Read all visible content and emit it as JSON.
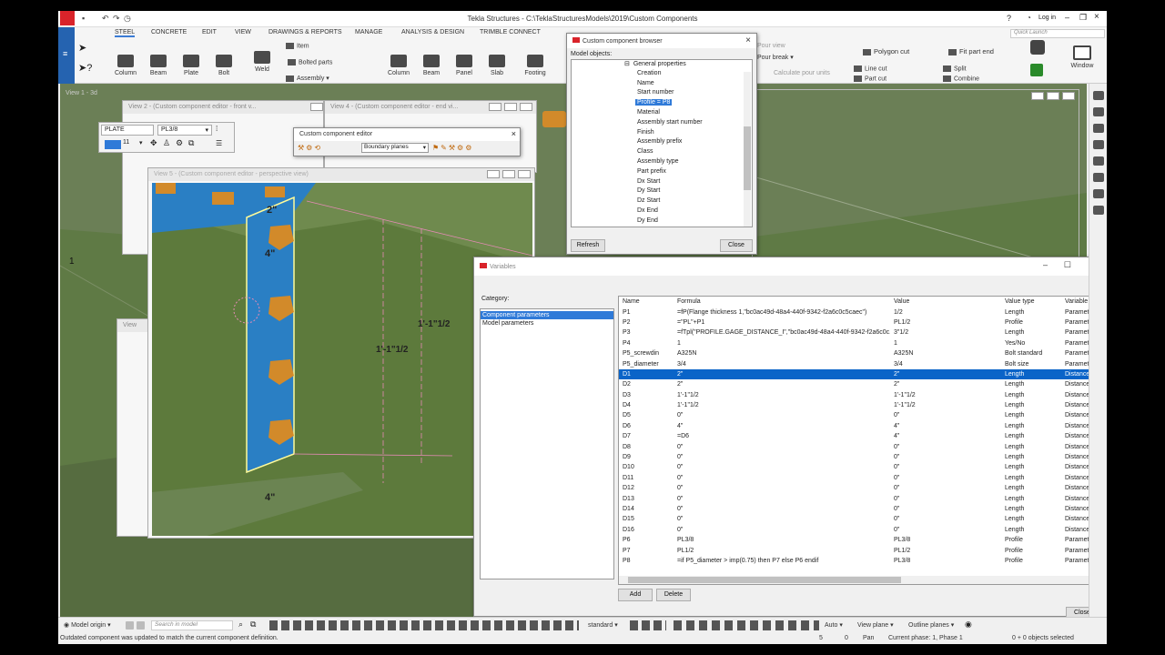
{
  "app": {
    "title": "Tekla Structures - C:\\TeklaStructuresModels\\2019\\Custom Components",
    "login": "Log in",
    "quick_launch": "Quick Launch"
  },
  "menu_tabs": [
    "STEEL",
    "CONCRETE",
    "EDIT",
    "VIEW",
    "DRAWINGS & REPORTS",
    "MANAGE",
    "ANALYSIS & DESIGN",
    "TRIMBLE CONNECT"
  ],
  "ribbon": {
    "steel": [
      {
        "label": "Column",
        "icon": "column-icon"
      },
      {
        "label": "Beam",
        "icon": "beam-icon"
      },
      {
        "label": "Plate",
        "icon": "plate-icon"
      },
      {
        "label": "Bolt",
        "icon": "bolt-icon"
      },
      {
        "label": "Weld",
        "icon": "weld-icon"
      }
    ],
    "steel_small": [
      "Item",
      "Bolted parts",
      "Assembly"
    ],
    "concrete": [
      {
        "label": "Column",
        "icon": "column-icon"
      },
      {
        "label": "Beam",
        "icon": "beam-icon"
      },
      {
        "label": "Panel",
        "icon": "panel-icon"
      },
      {
        "label": "Slab",
        "icon": "slab-icon"
      },
      {
        "label": "Footing",
        "icon": "footing-icon"
      }
    ],
    "pour": [
      "Pour view",
      "Pour break",
      "Calculate pour units"
    ],
    "edit_small": [
      "Polygon cut",
      "Line cut",
      "Part cut",
      "Fit part end",
      "Split",
      "Combine"
    ],
    "window_label": "Window"
  },
  "views": {
    "v1": "View 1 - 3d",
    "v2": "View 2 - (Custom component editor - front v...",
    "v4": "View 4 - (Custom component editor - end vi...",
    "v5": "View 5 - (Custom component editor - perspective view)",
    "vleft": "View"
  },
  "plate_toolbar": {
    "type": "PLATE",
    "profile": "PL3/8",
    "number": "11"
  },
  "cce": {
    "title": "Custom component editor",
    "dropdown": "Boundary planes"
  },
  "browser": {
    "title": "Custom component browser",
    "label": "Model objects:",
    "root": "General properties",
    "items": [
      "Creation",
      "Name",
      "Start number",
      "Profile = P8",
      "Material",
      "Assembly start number",
      "Finish",
      "Assembly prefix",
      "Class",
      "Assembly type",
      "Part prefix",
      "Dx Start",
      "Dy Start",
      "Dz Start",
      "Dx End",
      "Dy End"
    ],
    "selected_index": 3,
    "refresh": "Refresh",
    "close": "Close"
  },
  "variables": {
    "title": "Variables",
    "category_label": "Category:",
    "categories": [
      "Component parameters",
      "Model parameters"
    ],
    "columns": [
      "Name",
      "Formula",
      "Value",
      "Value type",
      "Variable typ"
    ],
    "rows": [
      [
        "P1",
        "=fP(Flange thickness 1,\"bc0ac49d-48a4-440f-9342-f2a6c0c5caec\")",
        "1/2",
        "Length",
        "Parameter"
      ],
      [
        "P2",
        "=\"PL\"+P1",
        "PL1/2",
        "Profile",
        "Parameter"
      ],
      [
        "P3",
        "=fTpl(\"PROFILE.GAGE_DISTANCE_I\",\"bc0ac49d-48a4-440f-9342-f2a6c0c...",
        "3\"1/2",
        "Length",
        "Parameter"
      ],
      [
        "P4",
        "1",
        "1",
        "Yes/No",
        "Parameter"
      ],
      [
        "P5_screwdin",
        "A325N",
        "A325N",
        "Bolt standard",
        "Parameter"
      ],
      [
        "P5_diameter",
        "3/4",
        "3/4",
        "Bolt size",
        "Parameter"
      ],
      [
        "D1",
        "2\"",
        "2\"",
        "Length",
        "Distance"
      ],
      [
        "D2",
        "2\"",
        "2\"",
        "Length",
        "Distance"
      ],
      [
        "D3",
        "1'-1\"1/2",
        "1'-1\"1/2",
        "Length",
        "Distance"
      ],
      [
        "D4",
        "1'-1\"1/2",
        "1'-1\"1/2",
        "Length",
        "Distance"
      ],
      [
        "D5",
        "0\"",
        "0\"",
        "Length",
        "Distance"
      ],
      [
        "D6",
        "4\"",
        "4\"",
        "Length",
        "Distance"
      ],
      [
        "D7",
        "=D6",
        "4\"",
        "Length",
        "Distance"
      ],
      [
        "D8",
        "0\"",
        "0\"",
        "Length",
        "Distance"
      ],
      [
        "D9",
        "0\"",
        "0\"",
        "Length",
        "Distance"
      ],
      [
        "D10",
        "0\"",
        "0\"",
        "Length",
        "Distance"
      ],
      [
        "D11",
        "0\"",
        "0\"",
        "Length",
        "Distance"
      ],
      [
        "D12",
        "0\"",
        "0\"",
        "Length",
        "Distance"
      ],
      [
        "D13",
        "0\"",
        "0\"",
        "Length",
        "Distance"
      ],
      [
        "D14",
        "0\"",
        "0\"",
        "Length",
        "Distance"
      ],
      [
        "D15",
        "0\"",
        "0\"",
        "Length",
        "Distance"
      ],
      [
        "D16",
        "0\"",
        "0\"",
        "Length",
        "Distance"
      ],
      [
        "P6",
        "PL3/8",
        "PL3/8",
        "Profile",
        "Parameter"
      ],
      [
        "P7",
        "PL1/2",
        "PL1/2",
        "Profile",
        "Parameter"
      ],
      [
        "P8",
        "=if P5_diameter > imp(0.75) then P7 else P6 endif",
        "PL3/8",
        "Profile",
        "Parameter"
      ]
    ],
    "selected_row": 6,
    "add": "Add",
    "delete": "Delete",
    "close": "Close"
  },
  "dims": {
    "top": "2\"",
    "upper": "4\"",
    "bottom": "4\"",
    "right1": "1'-1\"1/2",
    "right2": "1'-1\"1/2"
  },
  "marker": "1",
  "bottombar": {
    "origin": "Model origin",
    "search": "Search in model",
    "standard": "standard",
    "auto": "Auto",
    "view_plane": "View plane",
    "outline": "Outline planes"
  },
  "status": {
    "message": "Outdated component was updated to match the current component definition.",
    "num1": "5",
    "num2": "0",
    "mode": "Pan",
    "phase": "Current phase: 1, Phase 1",
    "selection": "0 + 0 objects selected"
  },
  "colors": {
    "accent": "#2f7ad8",
    "plate": "#2a7fc4",
    "bolt": "#d28a2a",
    "ground": "#5d7a3c",
    "logo": "#d9232a"
  }
}
